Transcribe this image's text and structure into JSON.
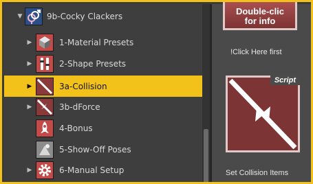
{
  "tree": {
    "items": [
      {
        "label": "9b-Cocky Clackers",
        "arrow": "▼",
        "icon": "gender-symbols-icon",
        "selected": false
      },
      {
        "label": "1-Material Presets",
        "arrow": "▶",
        "icon": "material-presets-icon",
        "selected": false
      },
      {
        "label": "2-Shape Presets",
        "arrow": "▶",
        "icon": "shape-presets-icon",
        "selected": false
      },
      {
        "label": "3a-Collision",
        "arrow": "▶",
        "icon": "collision-icon",
        "selected": true
      },
      {
        "label": "3b-dForce",
        "arrow": "▶",
        "icon": "dforce-icon",
        "selected": false
      },
      {
        "label": "4-Bonus",
        "arrow": "",
        "icon": "rocket-icon",
        "selected": false
      },
      {
        "label": "5-Show-Off Poses",
        "arrow": "",
        "icon": "pose-icon",
        "selected": false
      },
      {
        "label": "6-Manual Setup",
        "arrow": "▶",
        "icon": "gear-icon",
        "selected": false
      }
    ]
  },
  "right": {
    "top_card_lines": [
      "Double-clic",
      "for info"
    ],
    "click_here_label": "!Click Here first",
    "script_badge": "Script",
    "collision_caption": "Set Collision Items"
  },
  "colors": {
    "selection": "#f2c21b",
    "card_red": "#8b3a3a"
  }
}
